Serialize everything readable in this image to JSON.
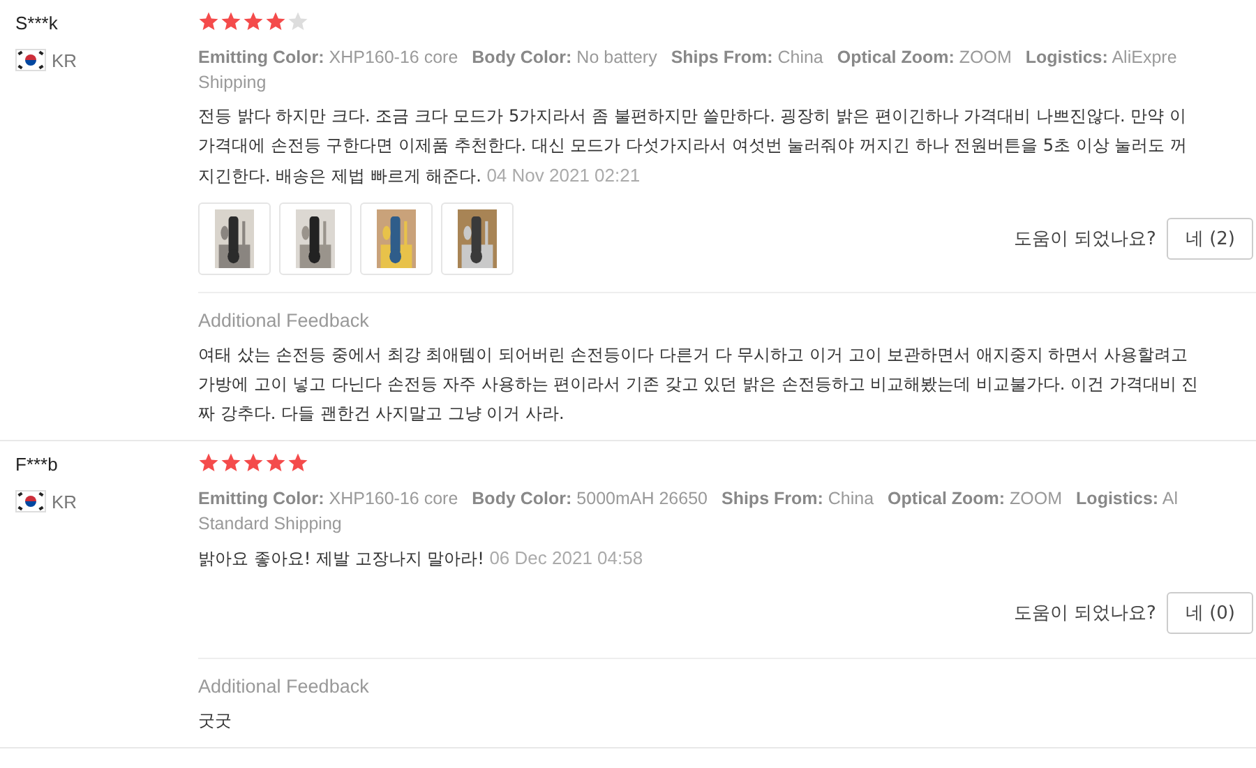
{
  "reviews": [
    {
      "user": "S***k",
      "country": "KR",
      "stars": 4,
      "attributes": [
        {
          "name": "Emitting Color:",
          "value": "XHP160-16 core"
        },
        {
          "name": "Body Color:",
          "value": "No battery"
        },
        {
          "name": "Ships From:",
          "value": "China"
        },
        {
          "name": "Optical Zoom:",
          "value": "ZOOM"
        },
        {
          "name": "Logistics:",
          "value": "AliExpre"
        }
      ],
      "attributes_wrapped": "Shipping",
      "text": "전등 밝다 하지만 크다. 조금 크다 모드가 5가지라서 좀 불편하지만 쓸만하다. 굉장히 밝은 편이긴하나 가격대비 나쁘진않다. 만약 이 가격대에 손전등 구한다면 이제품 추천한다. 대신 모드가 다섯가지라서 여섯번 눌러줘야 꺼지긴 하나 전원버튼을 5초 이상 눌러도 꺼지긴한다. 배송은 제법 빠르게 해준다.",
      "date": "04 Nov 2021 02:21",
      "photos": [
        {
          "kind": "picture"
        },
        {
          "kind": "picture"
        },
        {
          "kind": "picture"
        },
        {
          "kind": "picture"
        }
      ],
      "helpful_label": "도움이 되었나요?",
      "helpful_button": "네 (2)",
      "feedback_title": "Additional Feedback",
      "feedback_text": "여태 샀는 손전등 중에서 최강 최애템이 되어버린 손전등이다 다른거 다 무시하고 이거 고이 보관하면서 애지중지 하면서 사용할려고 가방에 고이 넣고 다닌다 손전등 자주 사용하는 편이라서 기존 갖고 있던 밝은 손전등하고 비교해봤는데 비교불가다. 이건 가격대비 진짜 강추다. 다들 괜한건 사지말고 그냥 이거 사라."
    },
    {
      "user": "F***b",
      "country": "KR",
      "stars": 5,
      "attributes": [
        {
          "name": "Emitting Color:",
          "value": "XHP160-16 core"
        },
        {
          "name": "Body Color:",
          "value": "5000mAH 26650"
        },
        {
          "name": "Ships From:",
          "value": "China"
        },
        {
          "name": "Optical Zoom:",
          "value": "ZOOM"
        },
        {
          "name": "Logistics:",
          "value": "Al"
        }
      ],
      "attributes_wrapped": "Standard Shipping",
      "text": "밝아요 좋아요! 제발 고장나지 말아라!",
      "date": "06 Dec 2021 04:58",
      "helpful_label": "도움이 되었나요?",
      "helpful_button": "네 (0)",
      "feedback_title": "Additional Feedback",
      "feedback_text": "굿굿"
    }
  ]
}
